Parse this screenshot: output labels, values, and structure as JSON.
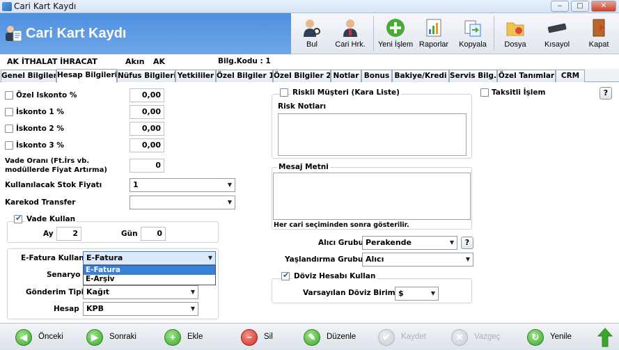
{
  "window": {
    "title": "Cari Kart Kaydı",
    "min": "‒",
    "max": "□",
    "close": "✕"
  },
  "header": {
    "title": "Cari Kart Kaydı"
  },
  "toolbar": {
    "bul": "Bul",
    "cari_hrk": "Cari Hrk.",
    "yeni_islem": "Yeni İşlem",
    "raporlar": "Raporlar",
    "kopyala": "Kopyala",
    "dosya": "Dosya",
    "kisayol": "Kısayol",
    "kapat": "Kapat"
  },
  "info": {
    "name": "AK İTHALAT İHRACAT",
    "person": "Akın",
    "code": "AK",
    "bilg_kodu": "Bilg.Kodu : 1"
  },
  "tabs": [
    "Genel Bilgiler",
    "Hesap Bilgileri",
    "Nüfus Bilgileri",
    "Yetkililer",
    "Özel Bilgiler 1",
    "Özel Bilgiler 2",
    "Notlar",
    "Bonus",
    "Bakiye/Kredi",
    "Servis Bilg.",
    "Özel Tanımlar",
    "CRM"
  ],
  "left": {
    "ozel_iskonto": {
      "label": "Özel Iskonto %",
      "value": "0,00"
    },
    "iskonto1": {
      "label": "İskonto 1 %",
      "value": "0,00"
    },
    "iskonto2": {
      "label": "İskonto 2 %",
      "value": "0,00"
    },
    "iskonto3": {
      "label": "İskonto 3 %",
      "value": "0,00"
    },
    "vade_orani": {
      "label1": "Vade Oranı (Ft.İrs vb.",
      "label2": "modüllerde Fiyat Artırma)",
      "value": "0"
    },
    "stok_fiyati": {
      "label": "Kullanılacak Stok Fiyatı",
      "value": "1"
    },
    "karekod": {
      "label": "Karekod Transfer",
      "value": ""
    },
    "vade_kullan": {
      "label": "Vade Kullan",
      "ay_label": "Ay",
      "ay": "2",
      "gun_label": "Gün",
      "gun": "0"
    },
    "efatura": {
      "label": "E-Fatura Kullan",
      "value": "E-Fatura",
      "options": [
        "E-Fatura",
        "E-Arşiv"
      ]
    },
    "senaryo": {
      "label": "Senaryo"
    },
    "gonderim": {
      "label": "Gönderim Tipi",
      "value": "Kağıt"
    },
    "hesap": {
      "label": "Hesap",
      "value": "KPB"
    }
  },
  "middle": {
    "riskli": "Riskli Müşteri (Kara Liste)",
    "risk_notlari": "Risk Notları",
    "mesaj_metni": "Mesaj Metni",
    "mesaj_hint": "Her cari seçiminden sonra gösterilir.",
    "alici_grubu": {
      "label": "Alıcı Grubu",
      "value": "Perakende"
    },
    "yaslandirma": {
      "label": "Yaşlandırma Grubu",
      "value": "Alıcı"
    },
    "doviz": {
      "label": "Döviz Hesabı Kullan",
      "birim_label": "Varsayılan Döviz Birimi",
      "birim": "$"
    }
  },
  "right": {
    "taksitli": "Taksitli İşlem",
    "help": "?"
  },
  "bottom": {
    "onceki": "Önceki",
    "sonraki": "Sonraki",
    "ekle": "Ekle",
    "sil": "Sil",
    "duzenle": "Düzenle",
    "kaydet": "Kaydet",
    "vazgec": "Vazgeç",
    "yenile": "Yenile"
  },
  "colors": {
    "header": "#5b98e4",
    "accent": "#3a80d8",
    "green": "#3aa52c",
    "red": "#d12a1e"
  }
}
